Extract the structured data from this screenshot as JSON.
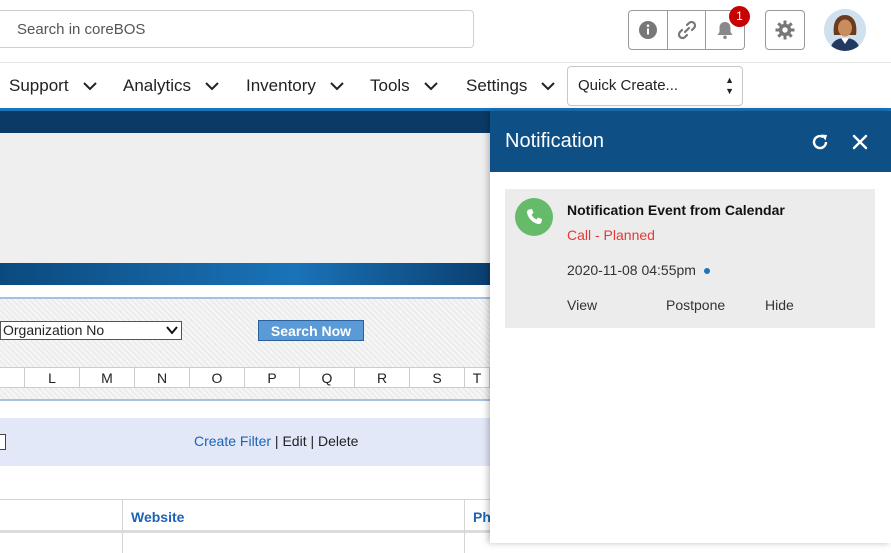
{
  "header": {
    "search_placeholder": "Search in coreBOS",
    "notification_count": "1",
    "icons": [
      "info-icon",
      "link-icon",
      "bell-icon",
      "gear-icon",
      "avatar"
    ]
  },
  "menu": {
    "items": [
      {
        "label": "Support"
      },
      {
        "label": "Analytics"
      },
      {
        "label": "Inventory"
      },
      {
        "label": "Tools"
      },
      {
        "label": "Settings"
      }
    ],
    "quick_create": "Quick Create..."
  },
  "search": {
    "field_select": "Organization No",
    "search_button": "Search Now",
    "alphabet": [
      "",
      "L",
      "M",
      "N",
      "O",
      "P",
      "Q",
      "R",
      "S",
      "T"
    ]
  },
  "filter": {
    "create": "Create Filter",
    "sep1": " | ",
    "edit": "Edit",
    "sep2": " | ",
    "delete": "Delete"
  },
  "table": {
    "columns": [
      "Website",
      "Ph"
    ]
  },
  "notification_panel": {
    "title": "Notification",
    "card": {
      "title": "Notification Event from Calendar",
      "subtitle": "Call - Planned",
      "datetime": "2020-11-08 04:55pm",
      "actions": [
        "View",
        "Postpone",
        "Hide"
      ]
    }
  },
  "colors": {
    "panel_header": "#0e4f86",
    "accent_blue": "#1b75bb",
    "badge_red": "#c70000",
    "call_green": "#66bb6a",
    "status_red": "#e53935"
  }
}
